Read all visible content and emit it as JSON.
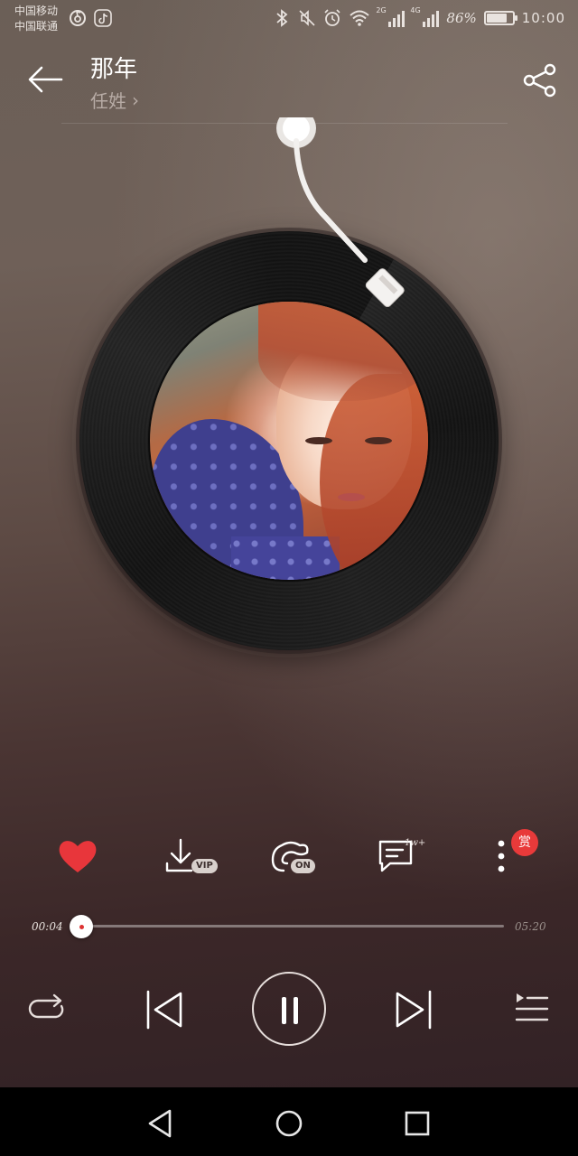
{
  "status_bar": {
    "carrier_1": "中国移动",
    "carrier_2": "中国联通",
    "app_icons": [
      "netease-music-icon",
      "tiktok-icon"
    ],
    "icons": [
      "bluetooth-icon",
      "mute-icon",
      "alarm-icon",
      "wifi-icon"
    ],
    "signal_1_label": "2G",
    "signal_2_label": "4G",
    "battery_percent": "86%",
    "battery_level": 0.86,
    "time": "10:00"
  },
  "header": {
    "title": "那年",
    "artist": "任姓",
    "artist_chevron": "›"
  },
  "actions": {
    "download_badge": "VIP",
    "sound_effect_badge": "ON",
    "comment_count": "1w+",
    "reward_badge": "赏",
    "accent_color": "#e83a3a"
  },
  "progress": {
    "current": "00:04",
    "total": "05:20",
    "fraction": 0.0125
  },
  "colors": {
    "accent": "#e83a3a",
    "progress_fill": "#dd3333"
  }
}
